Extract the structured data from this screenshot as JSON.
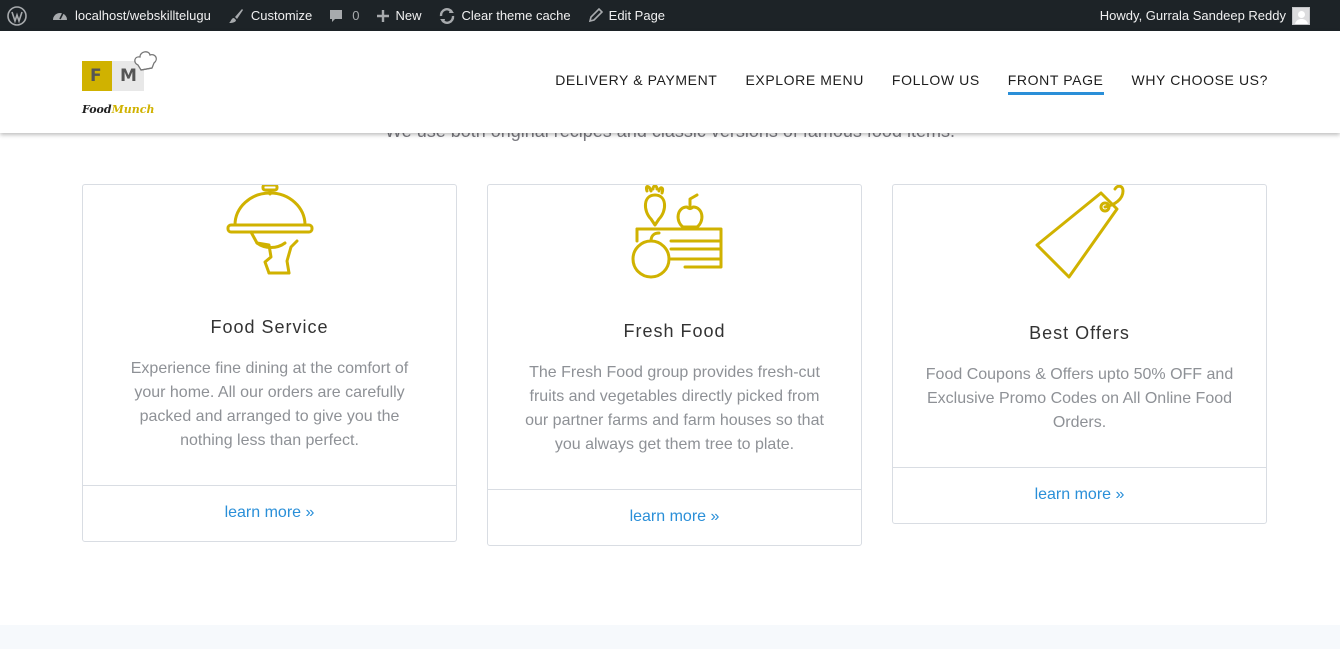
{
  "admin_bar": {
    "site": "localhost/webskilltelugu",
    "customize": "Customize",
    "comments_count": "0",
    "new": "New",
    "clear_cache": "Clear theme cache",
    "edit_page": "Edit Page",
    "howdy": "Howdy, Gurrala Sandeep Reddy"
  },
  "logo": {
    "letter_f": "F",
    "letter_m": "M",
    "text_a": "Food",
    "text_b": "Munch"
  },
  "nav": {
    "items": [
      {
        "label": "DELIVERY & PAYMENT"
      },
      {
        "label": "EXPLORE MENU"
      },
      {
        "label": "FOLLOW US"
      },
      {
        "label": "FRONT PAGE"
      },
      {
        "label": "WHY CHOOSE US?"
      }
    ],
    "active_index": 3
  },
  "section": {
    "subtitle": "We use both original recipes and classic versions of famous food items."
  },
  "cards": [
    {
      "icon": "cloche-icon",
      "title": "Food Service",
      "text": "Experience fine dining at the comfort of your home. All our orders are carefully packed and arranged to give you the nothing less than perfect.",
      "link": "learn more »"
    },
    {
      "icon": "fruit-basket-icon",
      "title": "Fresh Food",
      "text": "The Fresh Food group provides fresh-cut fruits and vegetables directly picked from our partner farms and farm houses so that you always get them tree to plate.",
      "link": "learn more »"
    },
    {
      "icon": "price-tag-icon",
      "title": "Best Offers",
      "text": "Food Coupons & Offers upto 50% OFF and Exclusive Promo Codes on All Online Food Orders.",
      "link": "learn more »"
    }
  ],
  "colors": {
    "accent": "#2a8fd8",
    "icon": "#d0b200",
    "admin_bar": "#1d2327"
  }
}
